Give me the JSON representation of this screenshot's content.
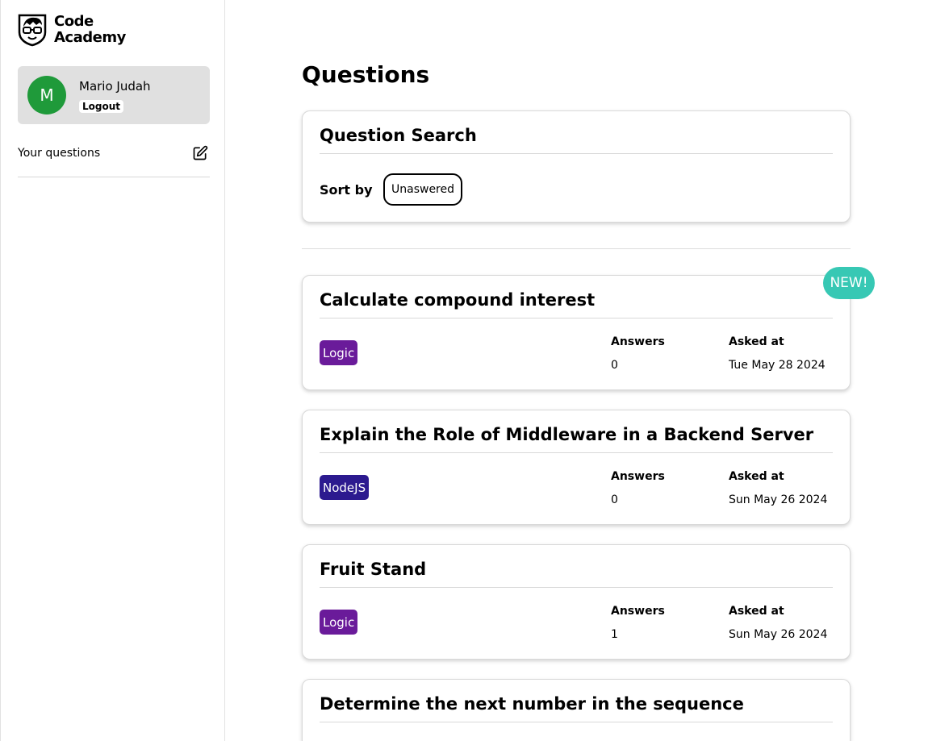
{
  "brand": {
    "line1": "Code",
    "line2": "Academy"
  },
  "user": {
    "initial": "M",
    "name": "Mario Judah",
    "logout_label": "Logout",
    "avatar_color": "#1f9a3a"
  },
  "sidebar": {
    "your_questions_label": "Your questions"
  },
  "main": {
    "title": "Questions",
    "search": {
      "title": "Question Search",
      "sort_label": "Sort by",
      "sort_value": "Unaswered"
    },
    "new_badge": "NEW!",
    "answers_header": "Answers",
    "asked_header": "Asked at",
    "questions": [
      {
        "title": "Calculate compound interest",
        "tag": "Logic",
        "tag_color": "#6a1b9a",
        "answers": "0",
        "asked_at": "Tue May 28 2024"
      },
      {
        "title": "Explain the Role of Middleware in a Backend Server",
        "tag": "NodeJS",
        "tag_color": "#2c1a8f",
        "answers": "0",
        "asked_at": "Sun May 26 2024"
      },
      {
        "title": "Fruit Stand",
        "tag": "Logic",
        "tag_color": "#6a1b9a",
        "answers": "1",
        "asked_at": "Sun May 26 2024"
      },
      {
        "title": "Determine the next number in the sequence"
      }
    ]
  }
}
